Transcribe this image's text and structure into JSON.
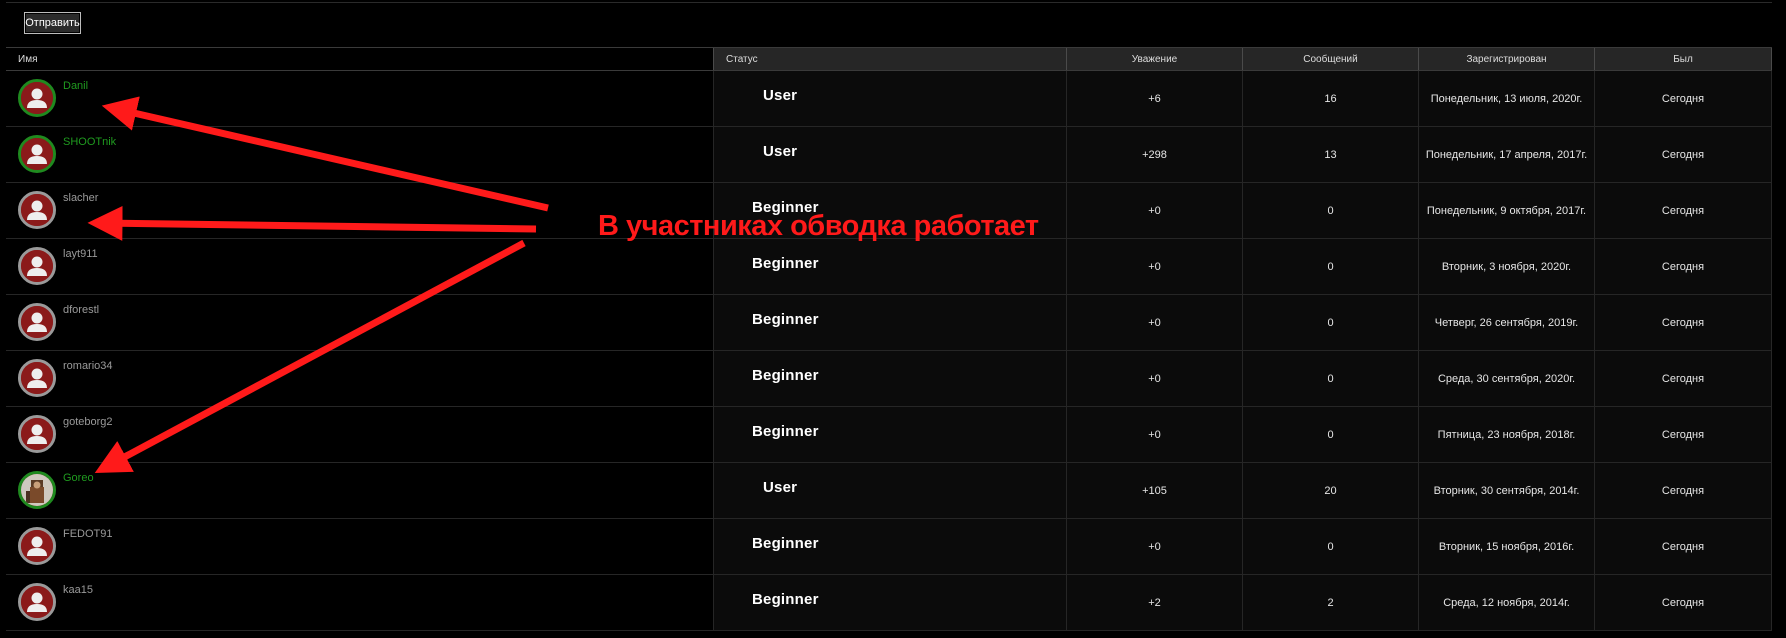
{
  "toolbar": {
    "submit_label": "Отправить"
  },
  "table": {
    "headers": {
      "name": "Имя",
      "status": "Статус",
      "respect": "Уважение",
      "messages": "Сообщений",
      "registered": "Зарегистрирован",
      "last_seen": "Был"
    },
    "rows": [
      {
        "username": "Danil",
        "status": "User",
        "respect": "+6",
        "messages": "16",
        "registered": "Понедельник, 13 июля, 2020г.",
        "last_seen": "Сегодня",
        "highlight": "green",
        "avatar": "default"
      },
      {
        "username": "SHOOTnik",
        "status": "User",
        "respect": "+298",
        "messages": "13",
        "registered": "Понедельник, 17 апреля, 2017г.",
        "last_seen": "Сегодня",
        "highlight": "green",
        "avatar": "default"
      },
      {
        "username": "slacher",
        "status": "Beginner",
        "respect": "+0",
        "messages": "0",
        "registered": "Понедельник, 9 октября, 2017г.",
        "last_seen": "Сегодня",
        "highlight": "gray",
        "avatar": "default"
      },
      {
        "username": "layt911",
        "status": "Beginner",
        "respect": "+0",
        "messages": "0",
        "registered": "Вторник, 3 ноября, 2020г.",
        "last_seen": "Сегодня",
        "highlight": "gray",
        "avatar": "default"
      },
      {
        "username": "dforestl",
        "status": "Beginner",
        "respect": "+0",
        "messages": "0",
        "registered": "Четверг, 26 сентября, 2019г.",
        "last_seen": "Сегодня",
        "highlight": "gray",
        "avatar": "default"
      },
      {
        "username": "romario34",
        "status": "Beginner",
        "respect": "+0",
        "messages": "0",
        "registered": "Среда, 30 сентября, 2020г.",
        "last_seen": "Сегодня",
        "highlight": "gray",
        "avatar": "default"
      },
      {
        "username": "goteborg2",
        "status": "Beginner",
        "respect": "+0",
        "messages": "0",
        "registered": "Пятница, 23 ноября, 2018г.",
        "last_seen": "Сегодня",
        "highlight": "gray",
        "avatar": "default"
      },
      {
        "username": "Goreo",
        "status": "User",
        "respect": "+105",
        "messages": "20",
        "registered": "Вторник, 30 сентября, 2014г.",
        "last_seen": "Сегодня",
        "highlight": "green",
        "avatar": "photo"
      },
      {
        "username": "FEDOT91",
        "status": "Beginner",
        "respect": "+0",
        "messages": "0",
        "registered": "Вторник, 15 ноября, 2016г.",
        "last_seen": "Сегодня",
        "highlight": "gray",
        "avatar": "default"
      },
      {
        "username": "kaa15",
        "status": "Beginner",
        "respect": "+2",
        "messages": "2",
        "registered": "Среда, 12 ноября, 2014г.",
        "last_seen": "Сегодня",
        "highlight": "gray",
        "avatar": "default"
      }
    ]
  },
  "annotation": {
    "text": "В участниках обводка работает",
    "color": "#ff1a1a"
  },
  "colors": {
    "highlight_green": "#1f8a1f",
    "avatar_bg": "#8b1a1a",
    "header_bg": "#262626"
  }
}
